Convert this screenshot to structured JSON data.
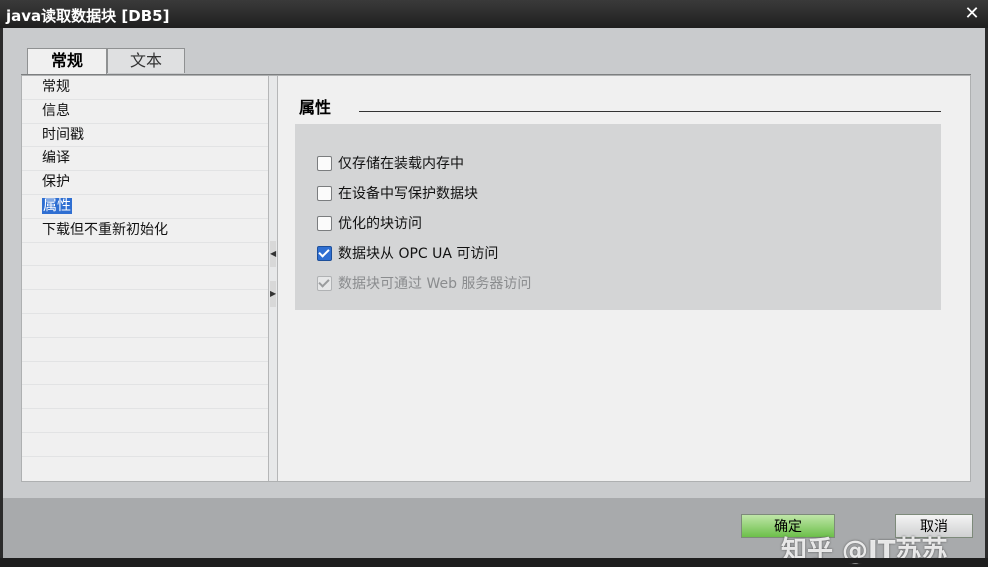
{
  "window": {
    "title": "java读取数据块 [DB5]",
    "close_label": "✕"
  },
  "tabs": [
    {
      "label": "常规",
      "active": true
    },
    {
      "label": "文本",
      "active": false
    }
  ],
  "nav": {
    "items": [
      {
        "label": "常规",
        "selected": false
      },
      {
        "label": "信息",
        "selected": false
      },
      {
        "label": "时间戳",
        "selected": false
      },
      {
        "label": "编译",
        "selected": false
      },
      {
        "label": "保护",
        "selected": false
      },
      {
        "label": "属性",
        "selected": true
      },
      {
        "label": "下载但不重新初始化",
        "selected": false
      }
    ]
  },
  "section": {
    "title": "属性",
    "options": [
      {
        "label": "仅存储在装载内存中",
        "checked": false,
        "enabled": true
      },
      {
        "label": "在设备中写保护数据块",
        "checked": false,
        "enabled": true
      },
      {
        "label": "优化的块访问",
        "checked": false,
        "enabled": true
      },
      {
        "label": "数据块从 OPC UA 可访问",
        "checked": true,
        "enabled": true
      },
      {
        "label": "数据块可通过 Web 服务器访问",
        "checked": true,
        "enabled": false
      }
    ]
  },
  "footer": {
    "ok_label": "确定",
    "cancel_label": "取消"
  },
  "watermark": "知乎 @IT苏苏"
}
